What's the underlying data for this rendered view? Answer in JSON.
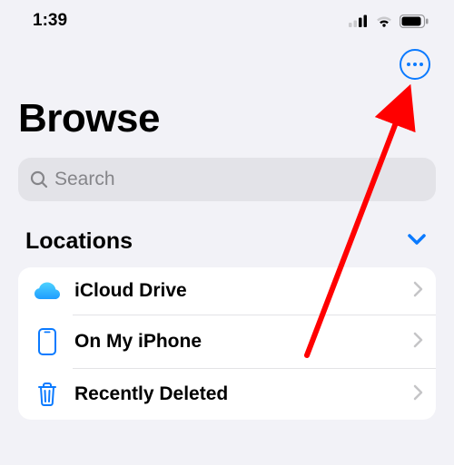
{
  "status": {
    "time": "1:39"
  },
  "page": {
    "title": "Browse"
  },
  "search": {
    "placeholder": "Search"
  },
  "section": {
    "title": "Locations"
  },
  "locations": {
    "items": [
      {
        "label": "iCloud Drive"
      },
      {
        "label": "On My iPhone"
      },
      {
        "label": "Recently Deleted"
      }
    ]
  },
  "colors": {
    "accent": "#0a7aff",
    "annotation": "#ff0000"
  }
}
